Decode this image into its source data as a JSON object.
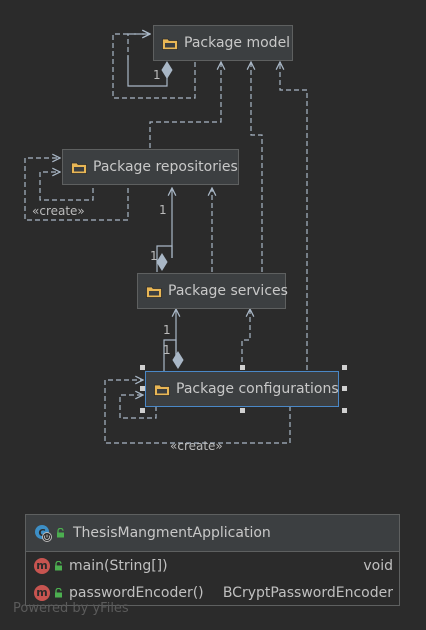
{
  "packages": {
    "model": "Package model",
    "repositories": "Package repositories",
    "services": "Package services",
    "configurations": "Package configurations"
  },
  "labels": {
    "create": "«create»",
    "multiplicity": "1"
  },
  "class_box": {
    "name": "ThesisMangmentApplication",
    "methods": [
      {
        "name": "main(String[])",
        "type": "void"
      },
      {
        "name": "passwordEncoder()",
        "type": "BCryptPasswordEncoder"
      }
    ]
  },
  "footer": "Powered by yFiles",
  "colors": {
    "background": "#2b2b2b",
    "node": "#3c3f41",
    "edge": "#a9b7c6",
    "selection": "#4a88c7",
    "folder": "#e8b655",
    "method": "#c75450",
    "lock": "#4caf50"
  }
}
